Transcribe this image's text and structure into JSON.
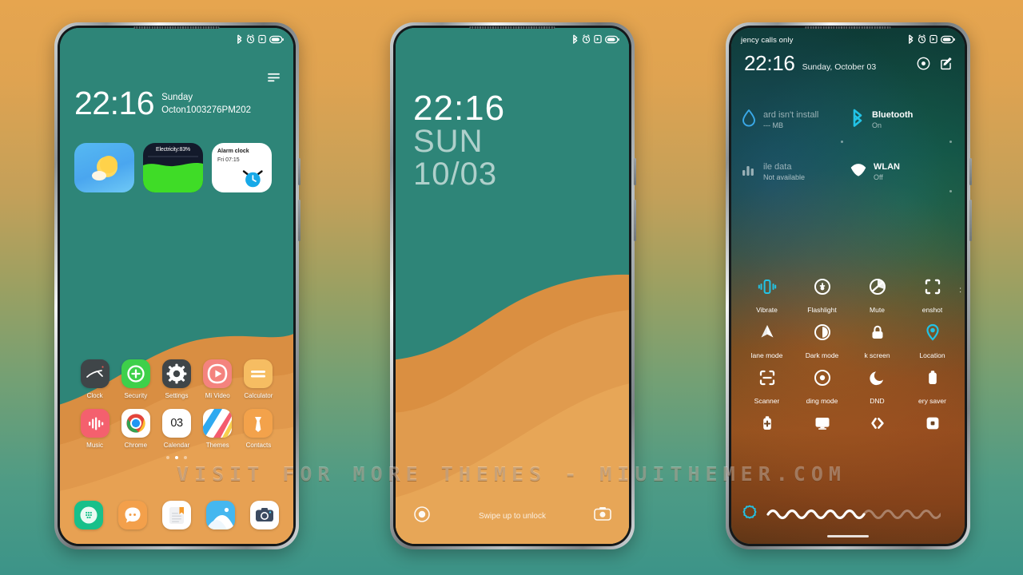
{
  "watermark": "VISIT FOR MORE THEMES - MIUITHEMER.COM",
  "status_bar": {
    "icons": [
      "bluetooth-icon",
      "alarm-icon",
      "dnd-icon",
      "battery-icon"
    ]
  },
  "phone1": {
    "screen_name": "home-screen",
    "clock": {
      "time": "22:16",
      "weekday": "Sunday",
      "date_line": "Octon1003276PM202"
    },
    "menu_icon": "hamburger-icon",
    "widgets": [
      {
        "name": "weather-widget",
        "icon": "sun-cloud-icon",
        "label": ""
      },
      {
        "name": "battery-widget",
        "label": "Electricity:83%",
        "percent": 83
      },
      {
        "name": "alarm-widget",
        "title": "Alarm clock",
        "subtitle": "Fri 07:15"
      }
    ],
    "apps_row1": [
      {
        "label": "Clock",
        "icon": "clock-icon"
      },
      {
        "label": "Security",
        "icon": "shield-plus-icon"
      },
      {
        "label": "Settings",
        "icon": "gear-icon"
      },
      {
        "label": "Mi Video",
        "icon": "play-icon"
      },
      {
        "label": "Calculator",
        "icon": "calculator-icon"
      }
    ],
    "apps_row2": [
      {
        "label": "Music",
        "icon": "music-bars-icon"
      },
      {
        "label": "Chrome",
        "icon": "chrome-icon"
      },
      {
        "label": "Calendar",
        "icon": "calendar-icon",
        "day": "03"
      },
      {
        "label": "Themes",
        "icon": "themes-icon"
      },
      {
        "label": "Contacts",
        "icon": "contacts-icon"
      }
    ],
    "dock": [
      {
        "name": "phone-app",
        "icon": "dialer-icon"
      },
      {
        "name": "messages-app",
        "icon": "messages-icon"
      },
      {
        "name": "notes-app",
        "icon": "notes-icon"
      },
      {
        "name": "gallery-app",
        "icon": "gallery-icon"
      },
      {
        "name": "camera-app",
        "icon": "camera-icon"
      }
    ],
    "page_dots": {
      "count": 3,
      "active_index": 1
    }
  },
  "phone2": {
    "screen_name": "lock-screen",
    "clock": {
      "time": "22:16",
      "weekday": "SUN",
      "date": "10/03"
    },
    "hint": "Swipe up to unlock",
    "left_shortcut": "flashlight-icon",
    "right_shortcut": "camera-icon"
  },
  "phone3": {
    "screen_name": "notification-shade",
    "carrier": "jency calls only",
    "clock": {
      "time": "22:16",
      "date": "Sunday, October 03"
    },
    "header_actions": [
      "settings-circle-icon",
      "edit-icon"
    ],
    "tiles": [
      {
        "name": "data-usage-tile",
        "title": "ard isn't install",
        "subtitle": "--- MB",
        "icon": "water-drop-icon",
        "dim": true
      },
      {
        "name": "bluetooth-tile",
        "title": "Bluetooth",
        "subtitle": "On",
        "icon": "bluetooth-icon",
        "dim": false
      },
      {
        "name": "mobile-data-tile",
        "title": "ile data",
        "subtitle": "Not available",
        "icon": "signal-bars-icon",
        "dim": true
      },
      {
        "name": "wlan-tile",
        "title": "WLAN",
        "subtitle": "Off",
        "icon": "wifi-icon",
        "dim": false
      }
    ],
    "quick_settings": [
      [
        {
          "label": "Vibrate",
          "icon": "vibrate-icon",
          "active": true
        },
        {
          "label": "Flashlight",
          "icon": "flashlight-icon",
          "active": false
        },
        {
          "label": "Mute",
          "icon": "mute-icon",
          "active": false
        },
        {
          "label": "enshot",
          "icon": "screenshot-icon",
          "active": false
        }
      ],
      [
        {
          "label": "lane mode",
          "icon": "airplane-icon",
          "active": false
        },
        {
          "label": "Dark mode",
          "icon": "dark-mode-icon",
          "active": false
        },
        {
          "label": "k screen",
          "icon": "lock-screen-icon",
          "active": false
        },
        {
          "label": "Location",
          "icon": "location-pin-icon",
          "active": true
        }
      ],
      [
        {
          "label": "Scanner",
          "icon": "scanner-icon",
          "active": false
        },
        {
          "label": "ding mode",
          "icon": "reading-mode-icon",
          "active": false
        },
        {
          "label": "DND",
          "icon": "moon-icon",
          "active": false
        },
        {
          "label": "ery saver",
          "icon": "battery-saver-icon",
          "active": false
        }
      ],
      [
        {
          "label": "",
          "icon": "ultra-battery-saver-icon",
          "active": false
        },
        {
          "label": "",
          "icon": "cast-screen-icon",
          "active": false
        },
        {
          "label": "",
          "icon": "sync-icon",
          "active": false
        },
        {
          "label": "",
          "icon": "second-space-icon",
          "active": false
        }
      ]
    ],
    "brightness": {
      "icon": "brightness-icon",
      "percent": 55
    },
    "more_indicator": ":"
  },
  "colors": {
    "accent_cyan": "#22c3e6",
    "screen_teal": "#2e8578",
    "wallpaper_orange": "#dd9144",
    "bg_top": "#e6a54f",
    "bg_bottom": "#3c9488"
  }
}
